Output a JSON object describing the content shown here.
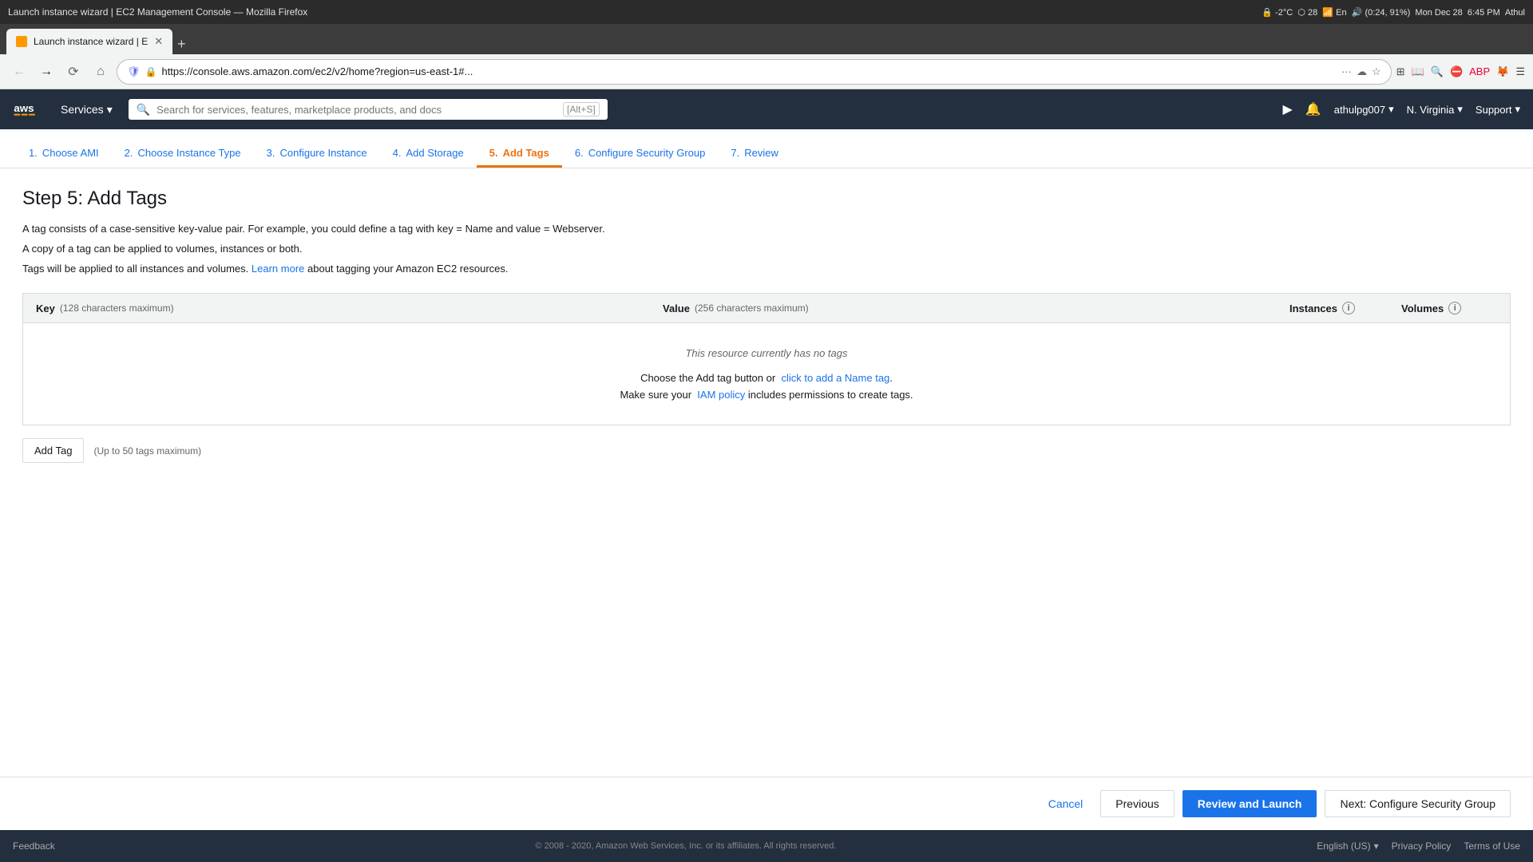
{
  "browser": {
    "title": "Launch instance wizard | EC2 Management Console — Mozilla Firefox",
    "tab_label": "Launch instance wizard | E",
    "url": "https://console.aws.amazon.com/ec2/v2/home?region=us-east-1#...",
    "url_display": "https://console.aws.amazon.com/ec2/v2/home?region=us-east-1#...",
    "new_tab_symbol": "+",
    "status_icons": "-2°C   En   (0:24, 91%)   Mon Dec 28  6:45 PM    Athul"
  },
  "aws_header": {
    "services_label": "Services",
    "search_placeholder": "Search for services, features, marketplace products, and docs",
    "search_shortcut": "[Alt+S]",
    "user": "athulpg007",
    "region": "N. Virginia",
    "support": "Support"
  },
  "wizard": {
    "steps": [
      {
        "num": "1.",
        "label": "Choose AMI",
        "active": false
      },
      {
        "num": "2.",
        "label": "Choose Instance Type",
        "active": false
      },
      {
        "num": "3.",
        "label": "Configure Instance",
        "active": false
      },
      {
        "num": "4.",
        "label": "Add Storage",
        "active": false
      },
      {
        "num": "5.",
        "label": "Add Tags",
        "active": true
      },
      {
        "num": "6.",
        "label": "Configure Security Group",
        "active": false
      },
      {
        "num": "7.",
        "label": "Review",
        "active": false
      }
    ],
    "page_title": "Step 5: Add Tags",
    "description_line1": "A tag consists of a case-sensitive key-value pair. For example, you could define a tag with key = Name and value = Webserver.",
    "description_line2": "A copy of a tag can be applied to volumes, instances or both.",
    "description_line3_before": "Tags will be applied to all instances and volumes.",
    "description_line3_link": "Learn more",
    "description_line3_after": "about tagging your Amazon EC2 resources.",
    "table": {
      "col_key": "Key",
      "col_key_sub": "(128 characters maximum)",
      "col_value": "Value",
      "col_value_sub": "(256 characters maximum)",
      "col_instances": "Instances",
      "col_volumes": "Volumes",
      "no_tags_text": "This resource currently has no tags",
      "add_name_tag_before": "Choose the Add tag button or",
      "add_name_tag_link": "click to add a Name tag",
      "add_name_tag_after": ".",
      "iam_before": "Make sure your",
      "iam_link": "IAM policy",
      "iam_after": "includes permissions to create tags."
    },
    "add_tag_btn": "Add Tag",
    "add_tag_hint": "(Up to 50 tags maximum)"
  },
  "footer_buttons": {
    "cancel": "Cancel",
    "previous": "Previous",
    "review_launch": "Review and Launch",
    "next": "Next: Configure Security Group"
  },
  "page_footer": {
    "feedback": "Feedback",
    "language": "English (US)",
    "copyright": "© 2008 - 2020, Amazon Web Services, Inc. or its affiliates. All rights reserved.",
    "privacy_policy": "Privacy Policy",
    "terms": "Terms of Use"
  }
}
